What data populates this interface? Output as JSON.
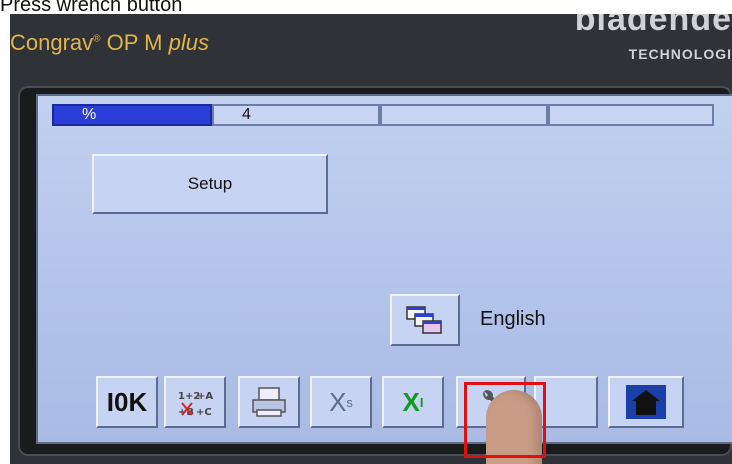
{
  "caption": "Press wrench button",
  "panel": {
    "brand": "Congrav",
    "brand_reg": "®",
    "brand_model": "OP M",
    "brand_plus": "plus",
    "maker_logo": "bladende",
    "maker_sub": "TECHNOLOGI"
  },
  "tabs": [
    {
      "label": "%",
      "active": true
    },
    {
      "label": "4",
      "active": false
    },
    {
      "label": "",
      "active": false
    },
    {
      "label": "",
      "active": false
    }
  ],
  "main": {
    "setup_label": "Setup",
    "language_label": "English"
  },
  "toolbar": {
    "ok_label": "I0K",
    "xs_label": "X",
    "xs_sub": "s",
    "xi_label": "X",
    "xi_sub": "I"
  },
  "colors": {
    "highlight": "#e01010",
    "screen_bg": "#b8c8ec",
    "active_tab": "#2b3fd8"
  }
}
